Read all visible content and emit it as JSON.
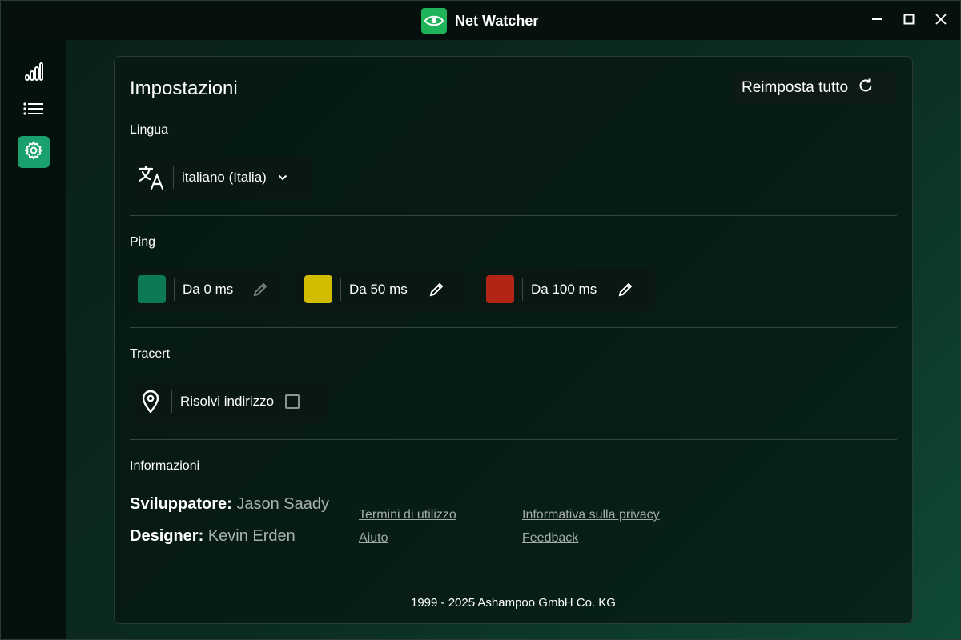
{
  "window": {
    "title": "Net Watcher",
    "logo_icon": "eye-icon",
    "controls": [
      "minimize-icon",
      "maximize-icon",
      "close-icon"
    ]
  },
  "sidebar": {
    "items": [
      {
        "name": "statistics",
        "icon": "signal-bars-icon",
        "active": false
      },
      {
        "name": "list",
        "icon": "list-icon",
        "active": false
      },
      {
        "name": "settings",
        "icon": "gear-icon",
        "active": true
      }
    ]
  },
  "settings": {
    "title": "Impostazioni",
    "reset_label": "Reimposta tutto",
    "language": {
      "section": "Lingua",
      "selected": "italiano (Italia)",
      "icon": "translate-icon"
    },
    "ping": {
      "section": "Ping",
      "thresholds": [
        {
          "label": "Da 0 ms",
          "color": "#0b7a55",
          "editable": false
        },
        {
          "label": "Da 50 ms",
          "color": "#d2bc00",
          "editable": true
        },
        {
          "label": "Da 100 ms",
          "color": "#b32417",
          "editable": true
        }
      ]
    },
    "tracert": {
      "section": "Tracert",
      "resolve_label": "Risolvi indirizzo",
      "resolve_checked": false
    },
    "info": {
      "section": "Informazioni",
      "developer_key": "Sviluppatore:",
      "developer_value": "Jason Saady",
      "designer_key": "Designer:",
      "designer_value": "Kevin Erden",
      "links": [
        "Termini di utilizzo",
        "Informativa sulla privacy",
        "Aiuto",
        "Feedback"
      ]
    },
    "copyright": "1999 - 2025 Ashampoo GmbH Co. KG"
  },
  "colors": {
    "accent": "#1aa06e",
    "logo_bg": "#1fb35a"
  }
}
